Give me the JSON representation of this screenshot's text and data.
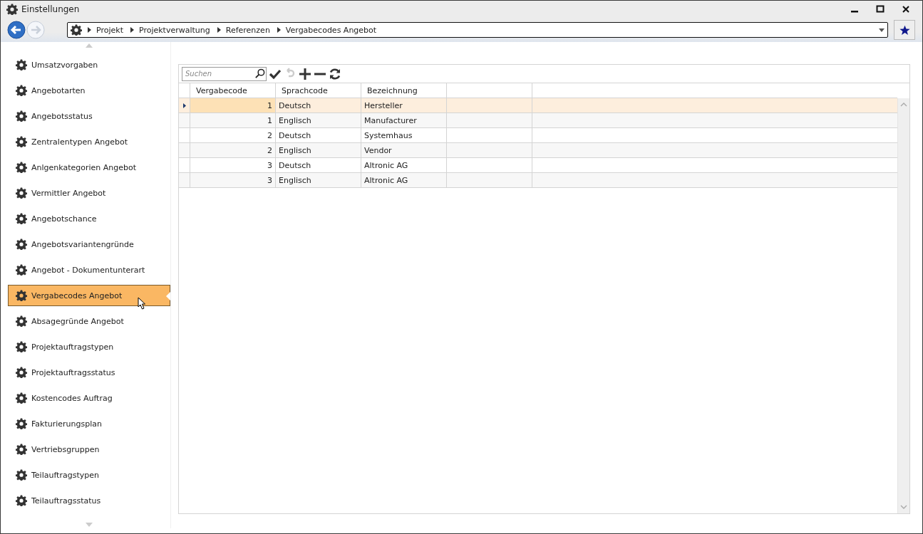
{
  "window": {
    "title": "Einstellungen"
  },
  "breadcrumb": [
    "Projekt",
    "Projektverwaltung",
    "Referenzen",
    "Vergabecodes Angebot"
  ],
  "sidebar": {
    "items": [
      {
        "label": "Umsatzvorgaben",
        "selected": false
      },
      {
        "label": "Angebotarten",
        "selected": false
      },
      {
        "label": "Angebotsstatus",
        "selected": false
      },
      {
        "label": "Zentralentypen Angebot",
        "selected": false
      },
      {
        "label": "Anlgenkategorien Angebot",
        "selected": false
      },
      {
        "label": "Vermittler Angebot",
        "selected": false
      },
      {
        "label": "Angebotschance",
        "selected": false
      },
      {
        "label": "Angebotsvariantengründe",
        "selected": false
      },
      {
        "label": "Angebot - Dokumentunterart",
        "selected": false
      },
      {
        "label": "Vergabecodes Angebot",
        "selected": true
      },
      {
        "label": "Absagegründe Angebot",
        "selected": false
      },
      {
        "label": "Projektauftragstypen",
        "selected": false
      },
      {
        "label": "Projektauftragsstatus",
        "selected": false
      },
      {
        "label": "Kostencodes Auftrag",
        "selected": false
      },
      {
        "label": "Fakturierungsplan",
        "selected": false
      },
      {
        "label": "Vertriebsgruppen",
        "selected": false
      },
      {
        "label": "Teilauftragstypen",
        "selected": false
      },
      {
        "label": "Teilauftragsstatus",
        "selected": false
      }
    ]
  },
  "search": {
    "placeholder": "Suchen"
  },
  "table": {
    "columns": [
      "Vergabecode",
      "Sprachcode",
      "Bezeichnung"
    ],
    "rows": [
      {
        "cells": [
          "1",
          "Deutsch",
          "Hersteller"
        ],
        "selected": true
      },
      {
        "cells": [
          "1",
          "Englisch",
          "Manufacturer"
        ],
        "selected": false
      },
      {
        "cells": [
          "2",
          "Deutsch",
          "Systemhaus"
        ],
        "selected": false
      },
      {
        "cells": [
          "2",
          "Englisch",
          "Vendor"
        ],
        "selected": false
      },
      {
        "cells": [
          "3",
          "Deutsch",
          "Altronic AG"
        ],
        "selected": false
      },
      {
        "cells": [
          "3",
          "Englisch",
          "Altronic AG"
        ],
        "selected": false
      }
    ]
  }
}
